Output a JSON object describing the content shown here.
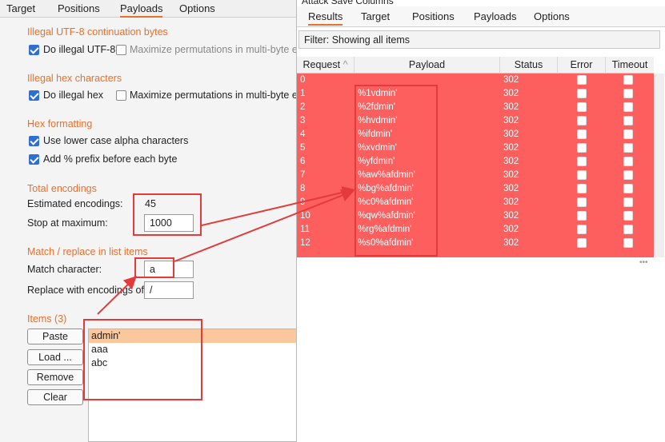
{
  "left": {
    "tabs": [
      "Target",
      "Positions",
      "Payloads",
      "Options"
    ],
    "sec_utf8": "Illegal UTF-8 continuation bytes",
    "utf8_do": "Do illegal UTF-8",
    "utf8_max": "Maximize permutations in multi-byte e",
    "sec_hex": "Illegal hex characters",
    "hex_do": "Do illegal hex",
    "hex_max": "Maximize permutations in multi-byte en",
    "sec_fmt": "Hex formatting",
    "fmt_lower": "Use lower case alpha characters",
    "fmt_prefix": "Add % prefix before each byte",
    "sec_total": "Total encodings",
    "est_label": "Estimated encodings:",
    "est_value": "45",
    "stop_label": "Stop at maximum:",
    "stop_value": "1000",
    "sec_match": "Match / replace in list items",
    "match_label": "Match character:",
    "match_value": "a",
    "replace_label": "Replace with encodings of:",
    "replace_value": "/",
    "sec_items": "Items (3)",
    "buttons": {
      "paste": "Paste",
      "load": "Load ...",
      "remove": "Remove",
      "clear": "Clear"
    },
    "items": [
      "admin'",
      "aaa",
      "abc"
    ]
  },
  "right": {
    "menu": "Attack   Save   Columns",
    "tabs": [
      "Results",
      "Target",
      "Positions",
      "Payloads",
      "Options"
    ],
    "filter": "Filter: Showing all items",
    "columns": [
      "Request",
      "Payload",
      "Status",
      "Error",
      "Timeout"
    ],
    "sort_indicator": "^",
    "rows": [
      {
        "req": "0",
        "payload": "",
        "status": "302"
      },
      {
        "req": "1",
        "payload": "%1vdmin'",
        "status": "302"
      },
      {
        "req": "2",
        "payload": "%2fdmin'",
        "status": "302"
      },
      {
        "req": "3",
        "payload": "%hvdmin'",
        "status": "302"
      },
      {
        "req": "4",
        "payload": "%ifdmin'",
        "status": "302"
      },
      {
        "req": "5",
        "payload": "%xvdmin'",
        "status": "302"
      },
      {
        "req": "6",
        "payload": "%yfdmin'",
        "status": "302"
      },
      {
        "req": "7",
        "payload": "%aw%afdmin'",
        "status": "302"
      },
      {
        "req": "8",
        "payload": "%bg%afdmin'",
        "status": "302"
      },
      {
        "req": "9",
        "payload": "%c0%afdmin'",
        "status": "302"
      },
      {
        "req": "10",
        "payload": "%qw%afdmin'",
        "status": "302"
      },
      {
        "req": "11",
        "payload": "%rg%afdmin'",
        "status": "302"
      },
      {
        "req": "12",
        "payload": "%s0%afdmin'",
        "status": "302"
      }
    ],
    "colors": {
      "row_bg": "#fd5e5e",
      "accent": "#e8702a",
      "highlight": "#e33b3b"
    }
  }
}
